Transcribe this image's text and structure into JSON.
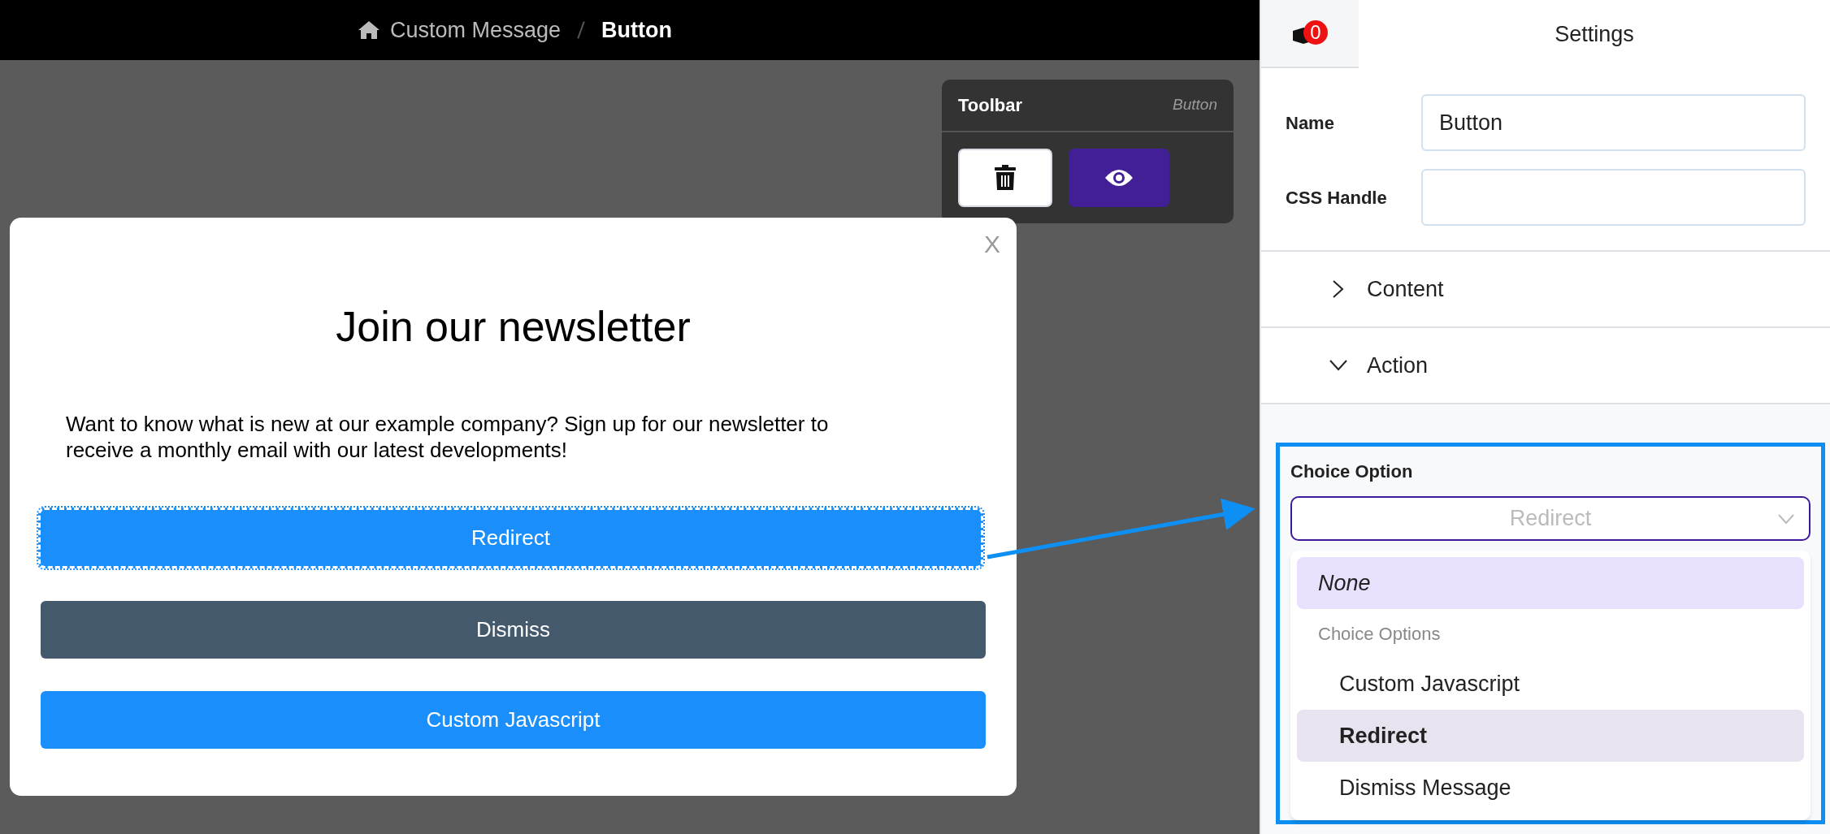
{
  "breadcrumb": [
    {
      "label": "Custom Message",
      "current": false
    },
    {
      "label": "Button",
      "current": true
    }
  ],
  "toolbar": {
    "title": "Toolbar",
    "subtitle": "Button",
    "buttons": [
      {
        "kind": "delete"
      },
      {
        "kind": "preview"
      }
    ]
  },
  "popup": {
    "close": "X",
    "title": "Join our newsletter",
    "body": "Want to know what is new at our example company? Sign up for our newsletter to receive a monthly email with our latest developments!",
    "buttons": [
      {
        "label": "Redirect",
        "color": "#1a8ffb",
        "selected": true
      },
      {
        "label": "Dismiss",
        "color": "#45596c",
        "selected": false
      },
      {
        "label": "Custom Javascript",
        "color": "#1a8ffb",
        "selected": false
      }
    ]
  },
  "settings": {
    "badge": "0",
    "title": "Settings",
    "fields": [
      {
        "label": "Name",
        "value": "Button"
      },
      {
        "label": "CSS Handle"
      }
    ],
    "sections": [
      {
        "label": "Content",
        "expanded": false
      },
      {
        "label": "Action",
        "expanded": true
      }
    ],
    "choice": {
      "label": "Choice Option",
      "value": "Redirect",
      "options": [
        {
          "kind": "empty",
          "label": "None",
          "highlighted": true,
          "selected": false
        },
        {
          "kind": "group",
          "label": "Choice Options"
        },
        {
          "kind": "option",
          "label": "Custom Javascript",
          "highlighted": false,
          "selected": false
        },
        {
          "kind": "option",
          "label": "Redirect",
          "highlighted": false,
          "selected": true
        },
        {
          "kind": "option",
          "label": "Dismiss Message",
          "highlighted": false,
          "selected": false
        }
      ]
    }
  }
}
